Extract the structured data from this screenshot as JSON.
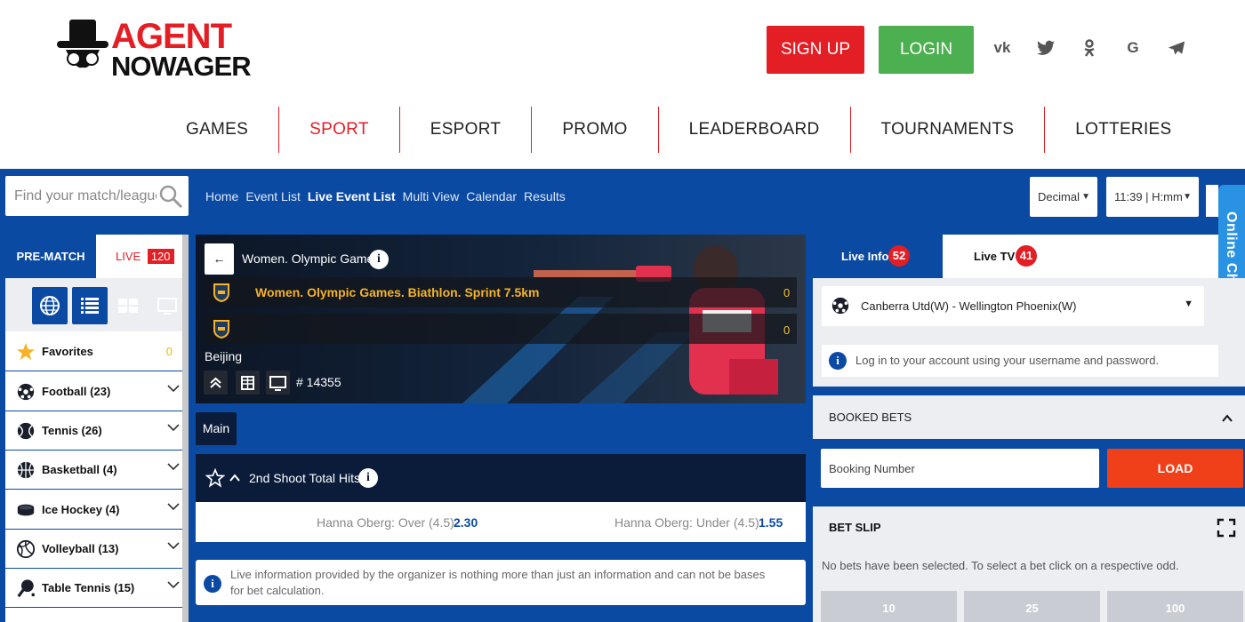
{
  "header": {
    "logo_line1": "AGENT",
    "logo_line2": "NOWAGER",
    "signup_label": "SIGN UP",
    "login_label": "LOGIN",
    "social": [
      "vk-icon",
      "twitter-icon",
      "odnoklassniki-icon",
      "google-icon",
      "telegram-icon"
    ],
    "nav": [
      "GAMES",
      "SPORT",
      "ESPORT",
      "PROMO",
      "LEADERBOARD",
      "TOURNAMENTS",
      "LOTTERIES"
    ],
    "nav_active": "SPORT"
  },
  "toolbar": {
    "search_placeholder": "Find your match/league",
    "links": [
      "Home",
      "Event List",
      "Live Event List",
      "Multi View",
      "Calendar",
      "Results"
    ],
    "active_link": "Live Event List",
    "odds_format": "Decimal",
    "time_format": "11:39 | H:mm"
  },
  "online_chat": "Online Chat",
  "sidebar": {
    "tab_prematch": "PRE-MATCH",
    "tab_live": "LIVE",
    "live_count": "120",
    "favorites": {
      "label": "Favorites",
      "count": "0"
    },
    "sports": [
      {
        "label": "Football (23)",
        "icon": "football-icon"
      },
      {
        "label": "Tennis (26)",
        "icon": "tennis-icon"
      },
      {
        "label": "Basketball (4)",
        "icon": "basketball-icon"
      },
      {
        "label": "Ice Hockey (4)",
        "icon": "ice-hockey-icon"
      },
      {
        "label": "Volleyball (13)",
        "icon": "volleyball-icon"
      },
      {
        "label": "Table Tennis (15)",
        "icon": "table-tennis-icon"
      }
    ]
  },
  "event": {
    "competition": "Women. Olympic Games",
    "team1": "Women. Olympic Games. Biathlon. Sprint 7.5km",
    "score1": "0",
    "team2": "",
    "score2": "0",
    "venue": "Beijing",
    "event_id": "# 14355"
  },
  "market": {
    "tab": "Main",
    "title": "2nd Shoot Total Hits",
    "over_label": "Hanna Oberg: Over (4.5)",
    "over_odd": "2.30",
    "under_label": "Hanna Oberg: Under (4.5)",
    "under_odd": "1.55"
  },
  "notice": "Live information provided by the organizer is nothing more than just an information and can not be bases for bet calculation.",
  "right": {
    "live_info_label": "Live Info",
    "live_info_count": "52",
    "live_tv_label": "Live TV",
    "live_tv_count": "41",
    "selected_match": "Canberra Utd(W) - Wellington Phoenix(W)",
    "login_note": "Log in to your account using your username and password.",
    "booked_bets": "BOOKED BETS",
    "booking_placeholder": "Booking Number",
    "load_label": "LOAD",
    "bet_slip": "BET SLIP",
    "bet_slip_msg": "No bets have been selected. To select a bet click on a respective odd.",
    "stakes": [
      "10",
      "25",
      "100"
    ]
  },
  "colors": {
    "brand_red": "#e31e24",
    "brand_blue": "#0b4aa3",
    "login_green": "#4caf50",
    "load_orange": "#f0401a",
    "dark_navy": "#0b1c3a"
  }
}
